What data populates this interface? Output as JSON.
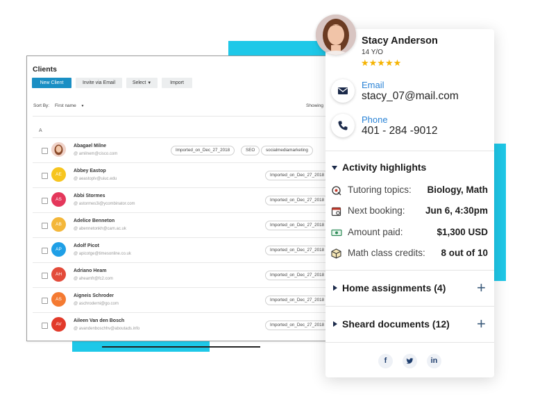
{
  "clients": {
    "title": "Clients",
    "buttons": {
      "new_client": "New Client",
      "invite": "Invite via Email",
      "select": "Select",
      "import": "Import"
    },
    "sort_label": "Sort By:",
    "sort_value": "First name",
    "showing": "Showing",
    "group_letter": "A",
    "rows": [
      {
        "name": "Abagael Milne",
        "email": "@ amilnem@cisco.com",
        "initials": "",
        "color": "#f0d2c8",
        "tags": [
          "Imported_on_Dec_27_2018",
          "SEO",
          "socialmediamarketing"
        ]
      },
      {
        "name": "Abbey Eastop",
        "email": "@ aeastoplv@uiuc.edu",
        "initials": "AE",
        "color": "#f7c51f",
        "tags": [
          "Imported_on_Dec_27_2018"
        ]
      },
      {
        "name": "Abbi Stormes",
        "email": "@ astormes3i@ycombinator.com",
        "initials": "AS",
        "color": "#e4375b",
        "tags": [
          "Imported_on_Dec_27_2018"
        ]
      },
      {
        "name": "Adelice Benneton",
        "email": "@ abennetonkh@cam.ac.uk",
        "initials": "AB",
        "color": "#f4b73a",
        "tags": [
          "Imported_on_Dec_27_2018"
        ]
      },
      {
        "name": "Adolf Picot",
        "email": "@ apicotge@timesonline.co.uk",
        "initials": "AP",
        "color": "#1f9fe6",
        "tags": [
          "Imported_on_Dec_27_2018"
        ]
      },
      {
        "name": "Adriano Heam",
        "email": "@ aheamfr@fc2.com",
        "initials": "AH",
        "color": "#e34b3a",
        "tags": [
          "Imported_on_Dec_27_2018"
        ]
      },
      {
        "name": "Aigneis Schroder",
        "email": "@ aschroderni@go.com",
        "initials": "AS",
        "color": "#f47a32",
        "tags": [
          "Imported_on_Dec_27_2018"
        ]
      },
      {
        "name": "Aileen Van den Bosch",
        "email": "@ avandenboschhv@aboutads.info",
        "initials": "AV",
        "color": "#e23a2a",
        "tags": [
          "Imported_on_Dec_27_2018"
        ]
      }
    ]
  },
  "profile": {
    "name": "Stacy Anderson",
    "age": "14 Y/O",
    "stars": "★★★★★",
    "email_label": "Email",
    "email": "stacy_07@mail.com",
    "phone_label": "Phone",
    "phone": "401 - 284 -9012",
    "activity_title": "Activity highlights",
    "highlights": [
      {
        "label": "Tutoring topics:",
        "value": "Biology, Math",
        "icon": "tutoring-icon"
      },
      {
        "label": "Next booking:",
        "value": "Jun 6, 4:30pm",
        "icon": "calendar-icon"
      },
      {
        "label": "Amount paid:",
        "value": "$1,300 USD",
        "icon": "money-icon"
      },
      {
        "label": "Math class credits:",
        "value": "8 out of 10",
        "icon": "box-icon"
      }
    ],
    "home_assignments": "Home assignments (4)",
    "shared_documents": "Sheard documents (12)",
    "social": {
      "facebook": "f",
      "twitter": "🐦",
      "linkedin": "in"
    }
  },
  "colors": {
    "accent": "#1ec8e8",
    "primary_button": "#1a8fc4",
    "star": "#f5b301",
    "label_blue": "#2a83d6"
  }
}
